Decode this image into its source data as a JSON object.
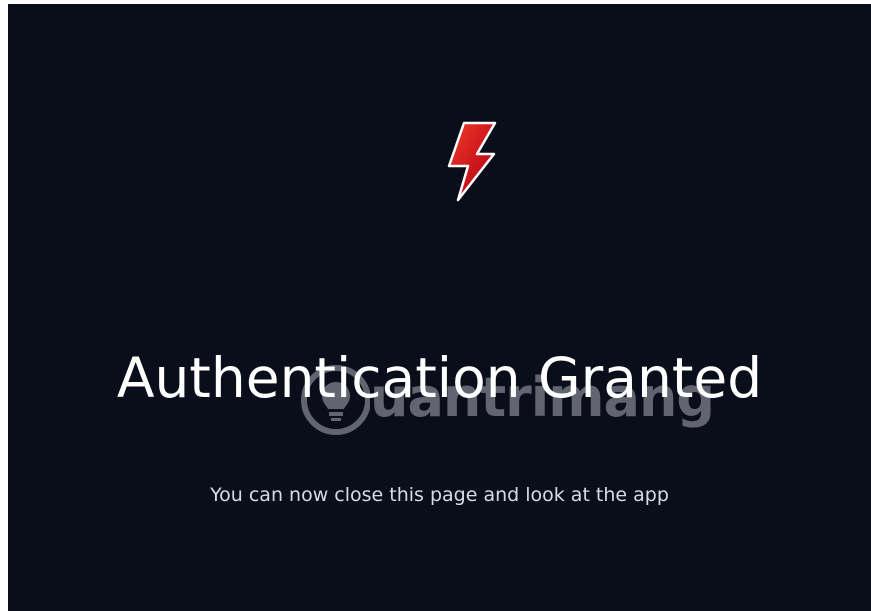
{
  "icons": {
    "logo": "lightning-bolt-icon",
    "watermark": "lightbulb-icon"
  },
  "colors": {
    "background": "#0a0e1a",
    "bolt_red": "#d11a1a",
    "bolt_outline": "#ffffff",
    "title_text": "#ffffff",
    "subtitle_text": "#d7dbe3"
  },
  "heading": "Authentication Granted",
  "message": "You can now close this page and look at the app",
  "watermark": {
    "text": "uantrimang"
  }
}
